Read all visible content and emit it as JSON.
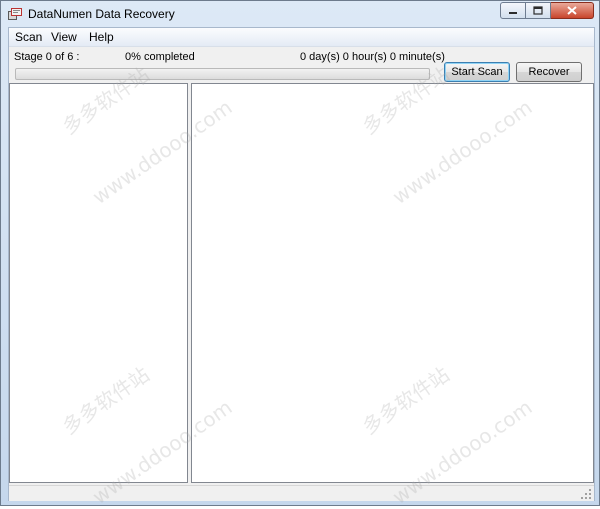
{
  "window": {
    "title": "DataNumen Data Recovery"
  },
  "menu": {
    "items": [
      "Scan",
      "View",
      "Help"
    ]
  },
  "status": {
    "stage": "Stage 0 of 6 :",
    "percent": "0% completed",
    "time": "0 day(s) 0 hour(s) 0 minute(s)",
    "progress_fraction": 0
  },
  "buttons": {
    "start_scan": "Start Scan",
    "recover": "Recover"
  },
  "watermark": {
    "text_cn": "多多软件站",
    "text_url": "www.ddooo.com"
  },
  "colors": {
    "progress_fill": "#37c837",
    "close_button": "#c9452c"
  }
}
